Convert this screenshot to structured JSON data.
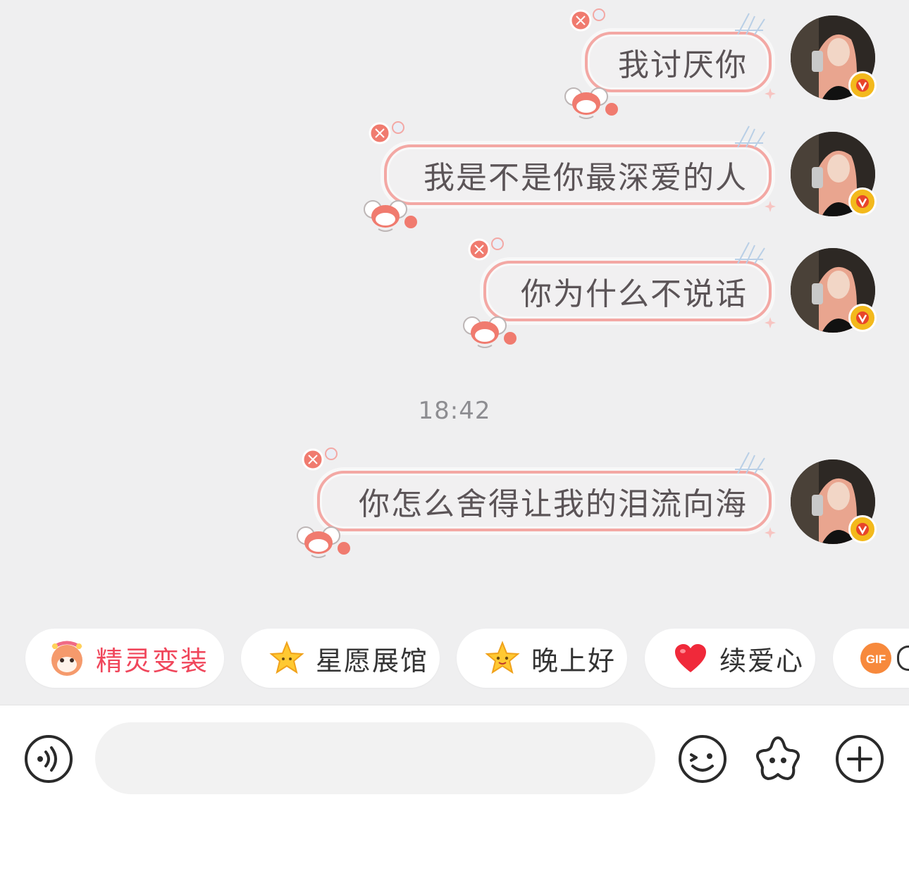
{
  "messages": [
    {
      "text": "我讨厌你"
    },
    {
      "text": "我是不是你最深爱的人"
    },
    {
      "text": "你为什么不说话"
    },
    {
      "text": "你怎么舍得让我的泪流向海"
    }
  ],
  "timestamp": "18:42",
  "quick_actions": [
    {
      "label": "精灵变装",
      "icon": "sprite-costume-icon"
    },
    {
      "label": "星愿展馆",
      "icon": "star-icon"
    },
    {
      "label": "晚上好",
      "icon": "smiling-star-icon"
    },
    {
      "label": "续爱心",
      "icon": "heart-icon"
    },
    {
      "label": "",
      "icon": "gif-icon"
    }
  ],
  "input": {
    "value": "",
    "placeholder": ""
  },
  "toolbar": {
    "left_icon": "voice-icon",
    "right_icons": [
      "emoji-icon",
      "sticker-star-icon",
      "plus-icon"
    ]
  },
  "colors": {
    "chat_background": "#efeff0",
    "bubble_border": "#f3a8a4",
    "bubble_text": "#5b5457",
    "accent_red": "#f0465b",
    "vip_badge": "#f3b91c"
  }
}
